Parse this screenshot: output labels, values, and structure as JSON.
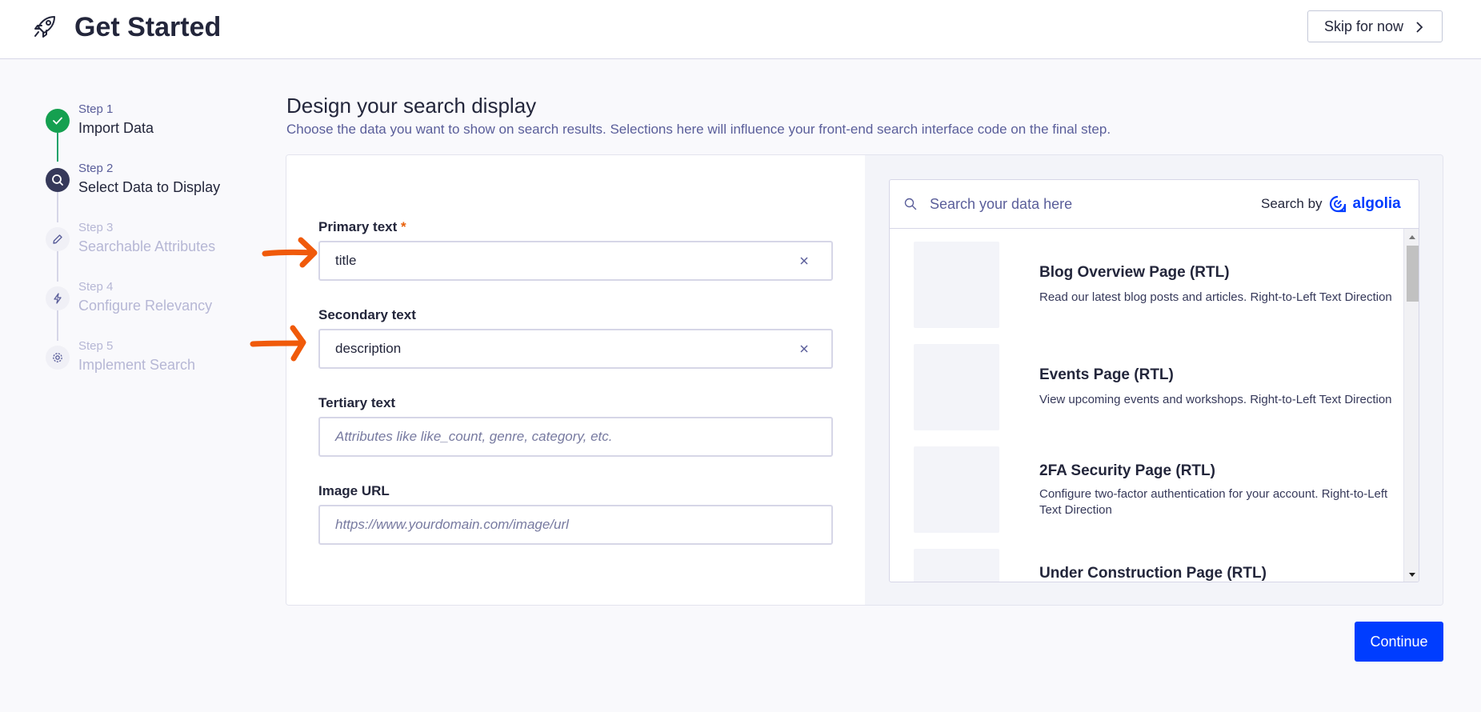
{
  "header": {
    "title": "Get Started",
    "skip_label": "Skip for now"
  },
  "steps": [
    {
      "num": "Step 1",
      "name": "Import Data",
      "state": "done"
    },
    {
      "num": "Step 2",
      "name": "Select Data to Display",
      "state": "active"
    },
    {
      "num": "Step 3",
      "name": "Searchable Attributes",
      "state": "todo"
    },
    {
      "num": "Step 4",
      "name": "Configure Relevancy",
      "state": "todo"
    },
    {
      "num": "Step 5",
      "name": "Implement Search",
      "state": "todo"
    }
  ],
  "section": {
    "title": "Design your search display",
    "subtitle": "Choose the data you want to show on search results. Selections here will influence your front-end search interface code on the final step."
  },
  "form": {
    "primary_label": "Primary text",
    "primary_required": "*",
    "primary_value": "title",
    "secondary_label": "Secondary text",
    "secondary_value": "description",
    "tertiary_label": "Tertiary text",
    "tertiary_placeholder": "Attributes like like_count, genre, category, etc.",
    "image_label": "Image URL",
    "image_placeholder": "https://www.yourdomain.com/image/url"
  },
  "preview": {
    "search_placeholder": "Search your data here",
    "search_by": "Search by",
    "brand": "algolia",
    "brand_color": "#003dff",
    "results": [
      {
        "title": "Blog Overview Page (RTL)",
        "desc": "Read our latest blog posts and articles. Right-to-Left Text Direction"
      },
      {
        "title": "Events Page (RTL)",
        "desc": "View upcoming events and workshops. Right-to-Left Text Direction"
      },
      {
        "title": "2FA Security Page (RTL)",
        "desc": "Configure two-factor authentication for your account. Right-to-Left Text Direction"
      },
      {
        "title": "Under Construction Page (RTL)",
        "desc": ""
      }
    ]
  },
  "footer": {
    "continue_label": "Continue"
  },
  "colors": {
    "accent": "#003dff",
    "done": "#15a050",
    "annotation_arrow": "#f05a0a"
  }
}
